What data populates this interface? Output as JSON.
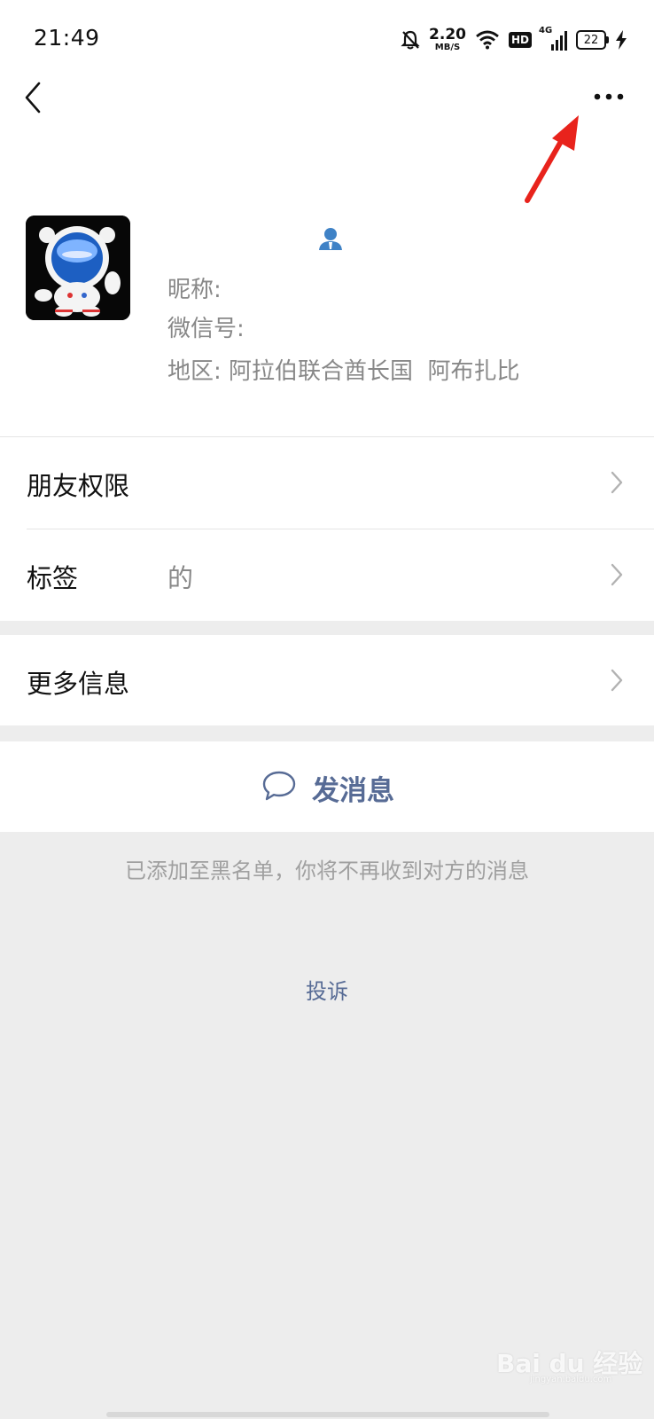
{
  "status_bar": {
    "time": "21:49",
    "net_speed_value": "2.20",
    "net_speed_unit": "MB/S",
    "hd_label": "HD",
    "network_label": "4G",
    "battery_level": "22",
    "icons": [
      "bell-muted-icon",
      "wifi-icon",
      "hd-icon",
      "signal-icon",
      "battery-icon",
      "charging-icon"
    ]
  },
  "nav": {
    "back_icon": "chevron-left-icon",
    "more_icon": "more-dots-icon"
  },
  "profile": {
    "name_icon": "person-icon",
    "nickname_label": "昵称:",
    "wechat_id_label": "微信号:",
    "region_label": "地区:",
    "region_value": "阿拉伯联合酋长国  阿布扎比"
  },
  "rows": {
    "friend_permissions": "朋友权限",
    "tags_label": "标签",
    "tags_value": "的",
    "more_info": "更多信息"
  },
  "actions": {
    "send_message": "发消息",
    "send_message_icon": "chat-bubble-icon"
  },
  "notice": "已添加至黑名单，你将不再收到对方的消息",
  "complaint": "投诉",
  "watermark": {
    "main": "Bai du 经验",
    "sub": "jingyan.baidu.com"
  },
  "colors": {
    "link_blue": "#576b95",
    "background": "#ededed",
    "annotation_red": "#e8231c"
  }
}
